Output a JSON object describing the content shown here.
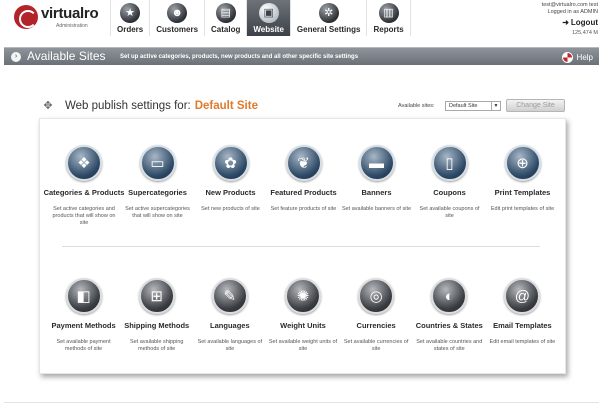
{
  "brand": {
    "name": "virtualro",
    "subtitle": "Administration"
  },
  "nav": {
    "items": [
      {
        "label": "Orders",
        "icon": "star-icon",
        "glyph": "★"
      },
      {
        "label": "Customers",
        "icon": "users-icon",
        "glyph": "☻"
      },
      {
        "label": "Catalog",
        "icon": "catalog-icon",
        "glyph": "▤"
      },
      {
        "label": "Website",
        "icon": "website-icon",
        "glyph": "▣"
      },
      {
        "label": "General Settings",
        "icon": "gear-icon",
        "glyph": "✲"
      },
      {
        "label": "Reports",
        "icon": "chart-icon",
        "glyph": "▥"
      }
    ],
    "active": "Website"
  },
  "user": {
    "email": "test@virtualro.com test",
    "status": "Logged in as ADMIN",
    "logout_label": "Logout",
    "storage": "125,474 M"
  },
  "titlebar": {
    "title": "Available Sites",
    "description": "Set up active categories, products, new products and all other specific site settings",
    "help_label": "Help"
  },
  "publish": {
    "label": "Web publish settings for:",
    "site_name": "Default Site",
    "available_label": "Available sites:",
    "selected_site": "Default Site",
    "change_button": "Change Site"
  },
  "tiles_row1": [
    {
      "title": "Categories & Products",
      "desc": "Set active categories and products that will show on site",
      "icon": "categories-products-icon",
      "glyph": "❖"
    },
    {
      "title": "Supercategories",
      "desc": "Set active supercategories that will show on site",
      "icon": "folder-icon",
      "glyph": "▭"
    },
    {
      "title": "New Products",
      "desc": "Set new products of site",
      "icon": "new-products-icon",
      "glyph": "✿"
    },
    {
      "title": "Featured Products",
      "desc": "Set feature products of site",
      "icon": "featured-products-icon",
      "glyph": "❦"
    },
    {
      "title": "Banners",
      "desc": "Set available banners of site",
      "icon": "banner-icon",
      "glyph": "▬"
    },
    {
      "title": "Coupons",
      "desc": "Set available coupons of site",
      "icon": "coupon-icon",
      "glyph": "▯"
    },
    {
      "title": "Print Templates",
      "desc": "Edit print templates of site",
      "icon": "print-template-icon",
      "glyph": "⊕"
    }
  ],
  "tiles_row2": [
    {
      "title": "Payment Methods",
      "desc": "Set available payment methods of site",
      "icon": "payment-icon",
      "glyph": "◧"
    },
    {
      "title": "Shipping Methods",
      "desc": "Set available shipping methods of site",
      "icon": "shipping-icon",
      "glyph": "⊞"
    },
    {
      "title": "Languages",
      "desc": "Set available languages of site",
      "icon": "feather-icon",
      "glyph": "✎"
    },
    {
      "title": "Weight Units",
      "desc": "Set available weight units of site",
      "icon": "gears-icon",
      "glyph": "✺"
    },
    {
      "title": "Currencies",
      "desc": "Set available currencies of site",
      "icon": "currency-icon",
      "glyph": "◎"
    },
    {
      "title": "Countries & States",
      "desc": "Set available countries and states of site",
      "icon": "globe-icon",
      "glyph": "◐"
    },
    {
      "title": "Email Templates",
      "desc": "Edit email templates of site",
      "icon": "at-sign-icon",
      "glyph": "@"
    }
  ],
  "colors": {
    "accent_orange": "#e07a2b",
    "titlebar_gray": "#7a8087",
    "brand_red": "#b3232a"
  }
}
